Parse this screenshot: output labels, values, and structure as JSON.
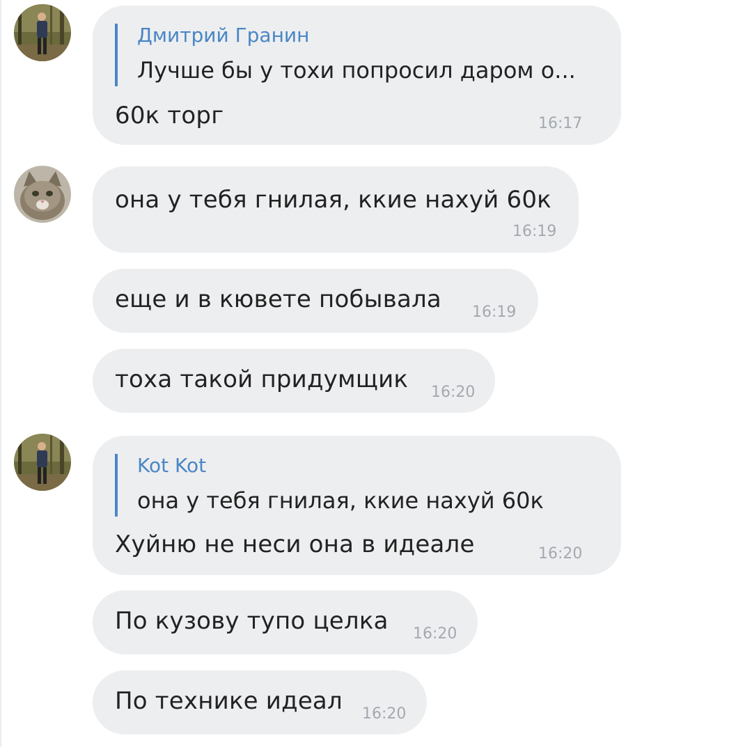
{
  "messages": [
    {
      "avatar": "avatar-person",
      "reply_author": "Дмитрий Гранин",
      "reply_text": "Лучше бы у тохи попросил даром о...",
      "text": "60к торг",
      "time": "16:17"
    },
    {
      "avatar": "avatar-cat",
      "text": "она у тебя гнилая, ккие нахуй 60к",
      "time": "16:19"
    },
    {
      "text": "еще и в кювете побывала",
      "time": "16:19"
    },
    {
      "text": "тоха такой придумщик",
      "time": "16:20"
    },
    {
      "avatar": "avatar-person",
      "reply_author": "Kot Kot",
      "reply_text": "она у тебя гнилая, ккие нахуй 60к",
      "text": "Хуйню не неси она в идеале",
      "time": "16:20"
    },
    {
      "text": "По кузову тупо целка",
      "time": "16:20"
    },
    {
      "text": "По технике идеал",
      "time": "16:20"
    }
  ],
  "colors": {
    "bubble_bg": "#edeef0",
    "reply_accent": "#4a86c5",
    "text": "#222222",
    "time": "#a4a9b0"
  }
}
